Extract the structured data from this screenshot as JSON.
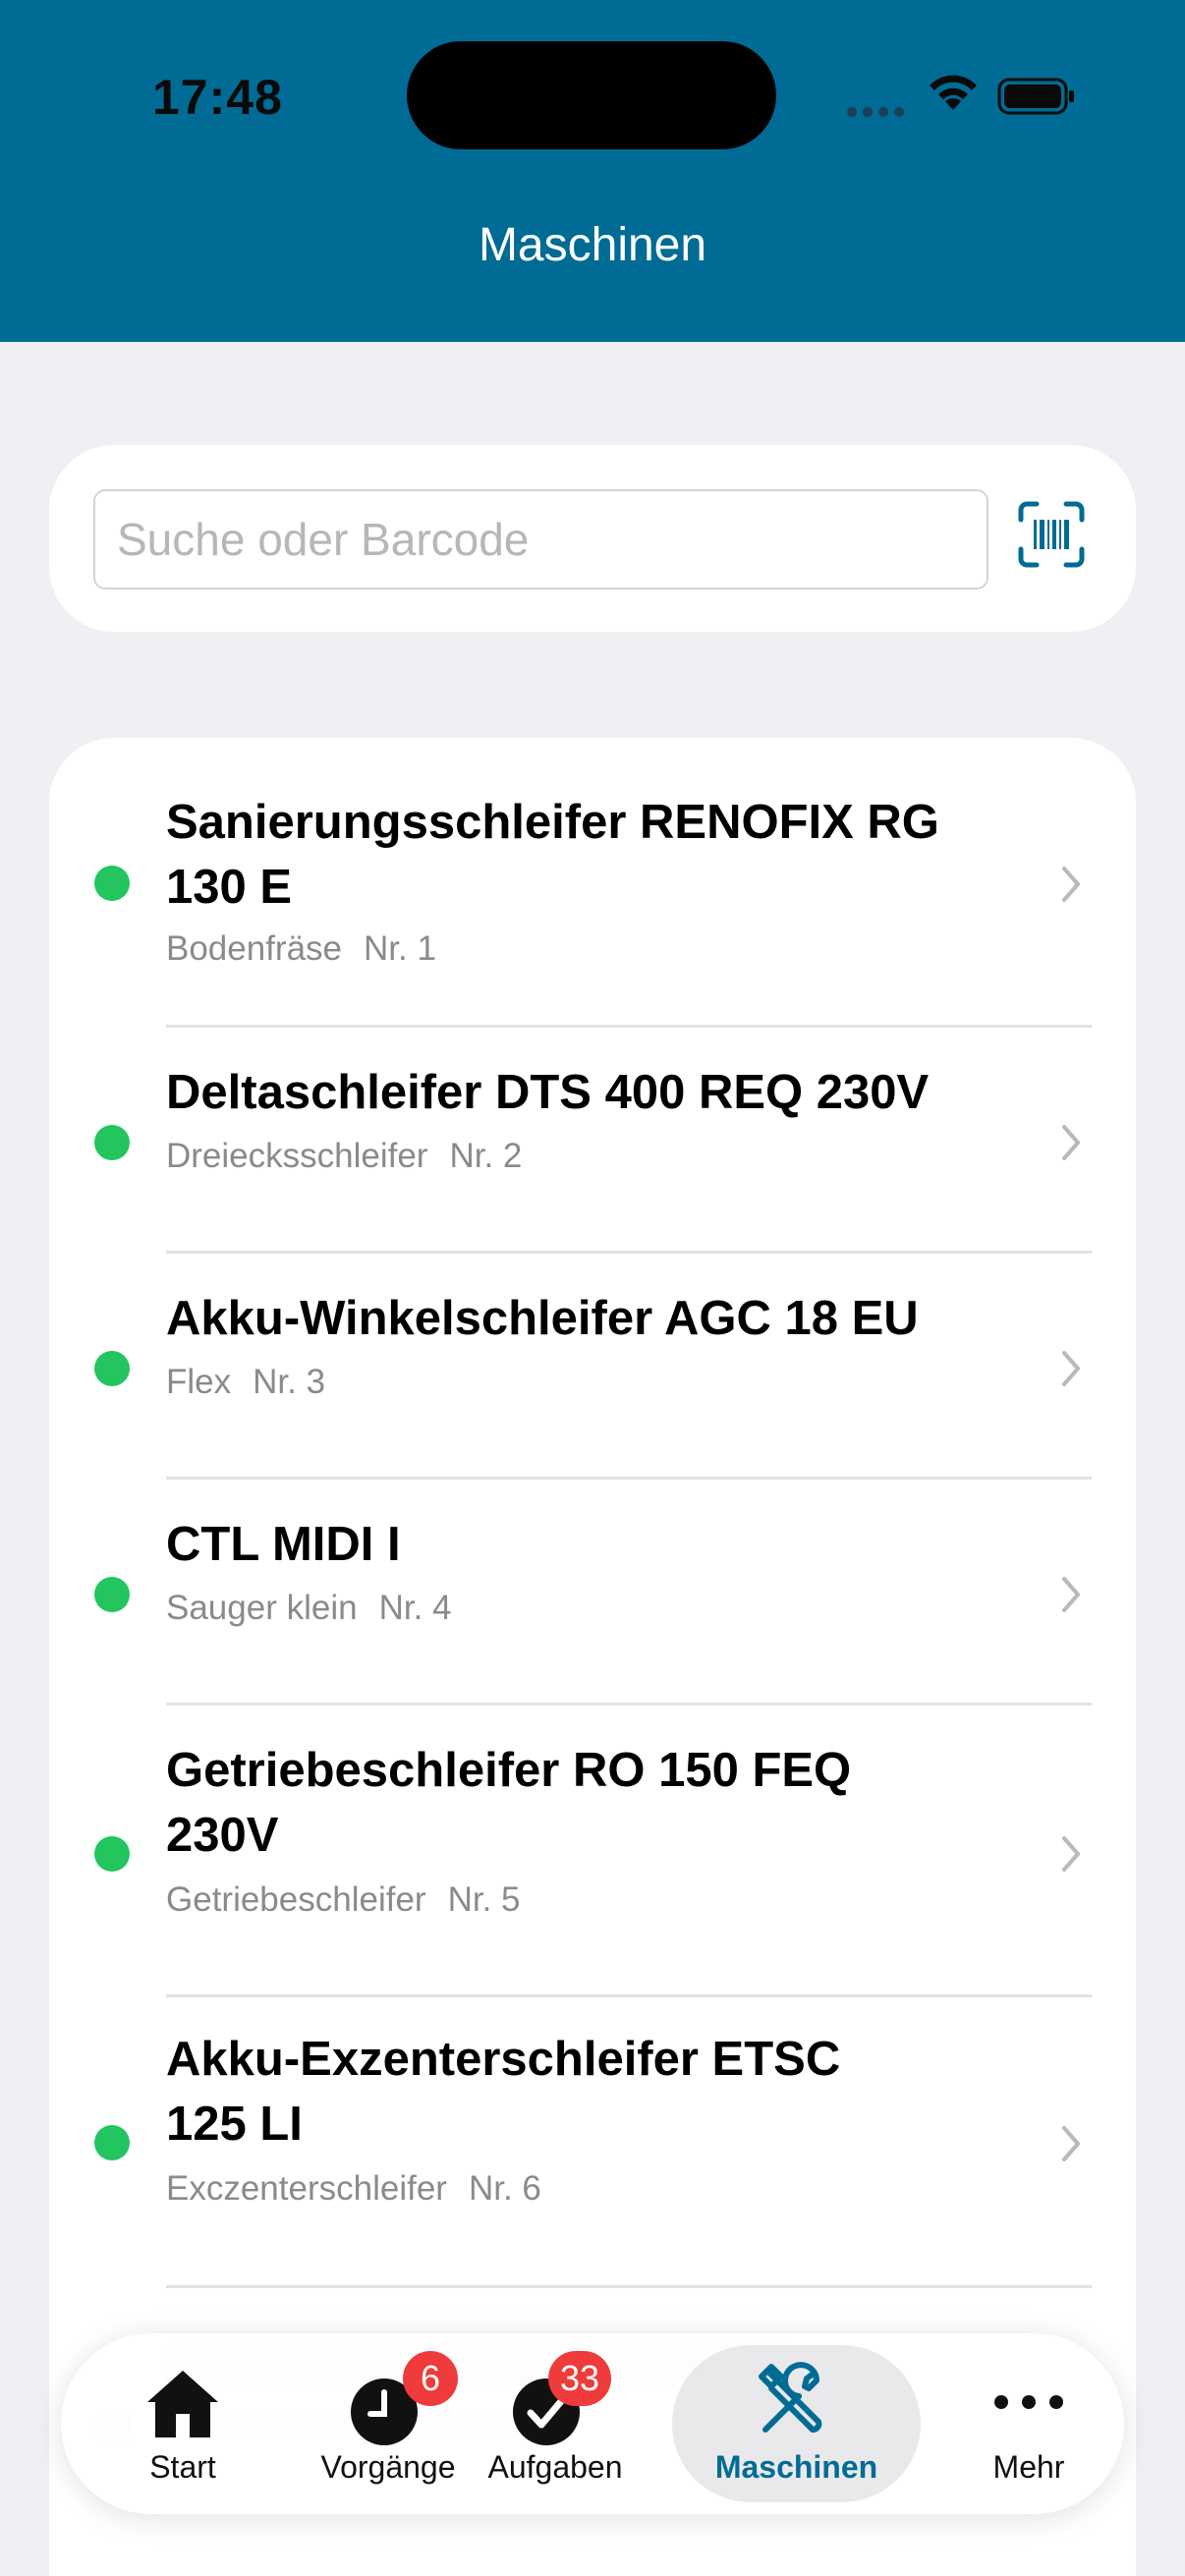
{
  "status_bar": {
    "time": "17:48"
  },
  "header": {
    "title": "Maschinen"
  },
  "search": {
    "placeholder": "Suche oder Barcode",
    "value": ""
  },
  "machines": [
    {
      "title_line1": "Sanierungsschleifer RENOFIX RG",
      "title_line2": "130 E",
      "category": "Bodenfräse",
      "number": "Nr. 1",
      "status": "available"
    },
    {
      "title_line1": "Deltaschleifer DTS 400 REQ 230V",
      "title_line2": "",
      "category": "Dreiecksschleifer",
      "number": "Nr. 2",
      "status": "available"
    },
    {
      "title_line1": "Akku-Winkelschleifer AGC 18 EU",
      "title_line2": "",
      "category": "Flex",
      "number": "Nr. 3",
      "status": "available"
    },
    {
      "title_line1": "CTL MIDI I",
      "title_line2": "",
      "category": "Sauger klein",
      "number": "Nr. 4",
      "status": "available"
    },
    {
      "title_line1": "Getriebeschleifer RO 150 FEQ",
      "title_line2": "230V",
      "category": "Getriebeschleifer",
      "number": "Nr. 5",
      "status": "available"
    },
    {
      "title_line1": "Akku-Exzenterschleifer ETSC",
      "title_line2": "125 LI",
      "category": "Exczenterschleifer",
      "number": "Nr. 6",
      "status": "available"
    }
  ],
  "tabbar": {
    "tabs": [
      {
        "label": "Start",
        "icon": "house-icon"
      },
      {
        "label": "Vorgänge",
        "icon": "clock-icon",
        "badge": "6"
      },
      {
        "label": "Aufgaben",
        "icon": "checkmark-icon",
        "badge": "33"
      },
      {
        "label": "Maschinen",
        "icon": "tools-icon",
        "active": true
      },
      {
        "label": "Mehr",
        "icon": "more-icon"
      }
    ]
  },
  "colors": {
    "brand": "#006b94",
    "status_available": "#22c55e",
    "badge": "#ef3b3b"
  }
}
